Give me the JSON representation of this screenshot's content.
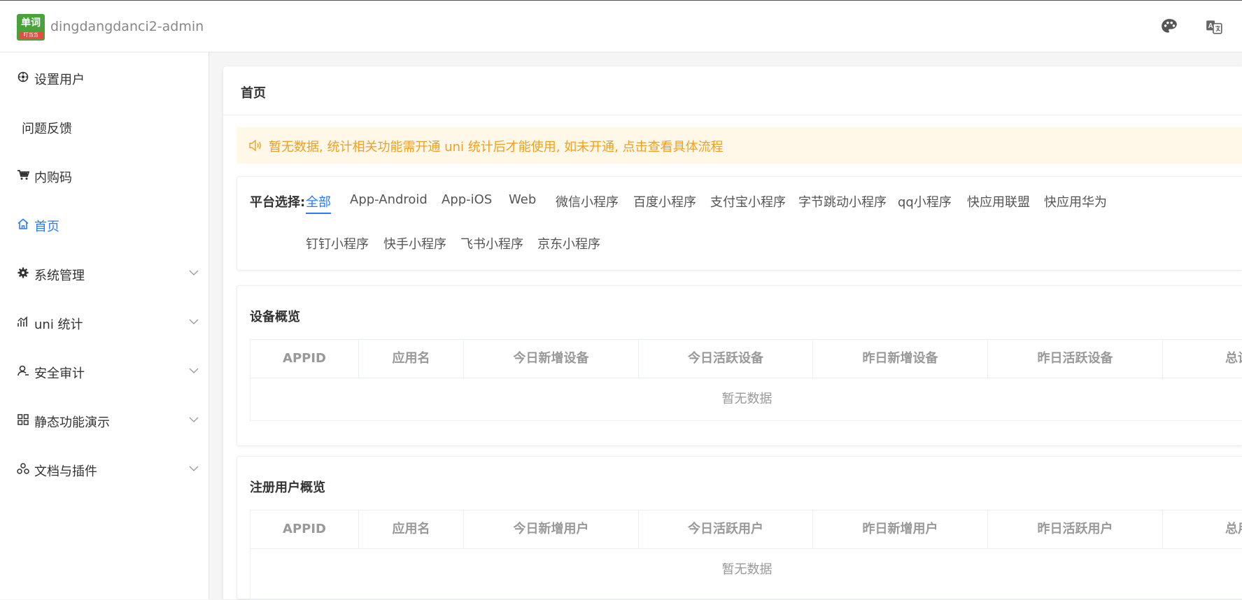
{
  "header": {
    "logo_text": "单词",
    "logo_sub": "叮当当",
    "app_title": "dingdangdanci2-admin",
    "icons": [
      "palette-icon",
      "translate-icon"
    ]
  },
  "sidebar": {
    "items": [
      {
        "label": "设置用户",
        "icon": "settings-user-icon"
      },
      {
        "label": "问题反馈",
        "icon": ""
      },
      {
        "label": "内购码",
        "icon": "cart-icon"
      },
      {
        "label": "首页",
        "icon": "home-icon",
        "active": true
      },
      {
        "label": "系统管理",
        "icon": "gear-icon",
        "expandable": true
      },
      {
        "label": "uni 统计",
        "icon": "stats-icon",
        "expandable": true
      },
      {
        "label": "安全审计",
        "icon": "user-audit-icon",
        "expandable": true
      },
      {
        "label": "静态功能演示",
        "icon": "grid-icon",
        "expandable": true
      },
      {
        "label": "文档与插件",
        "icon": "plugin-icon",
        "expandable": true
      }
    ]
  },
  "main": {
    "title": "首页",
    "notice": "暂无数据, 统计相关功能需开通 uni 统计后才能使用, 如未开通, 点击查看具体流程",
    "platform": {
      "label": "平台选择:",
      "tabs": [
        "全部",
        "App-Android",
        "App-iOS",
        "Web",
        "微信小程序",
        "百度小程序",
        "支付宝小程序",
        "字节跳动小程序",
        "qq小程序",
        "快应用联盟",
        "快应用华为",
        "钉钉小程序",
        "快手小程序",
        "飞书小程序",
        "京东小程序"
      ],
      "selected": "全部"
    },
    "device_overview": {
      "title": "设备概览",
      "columns": [
        "APPID",
        "应用名",
        "今日新增设备",
        "今日活跃设备",
        "昨日新增设备",
        "昨日活跃设备",
        "总设备数"
      ],
      "empty_text": "暂无数据"
    },
    "user_overview": {
      "title": "注册用户概览",
      "columns": [
        "APPID",
        "应用名",
        "今日新增用户",
        "今日活跃用户",
        "昨日新增用户",
        "昨日活跃用户",
        "总用户数"
      ],
      "empty_text": "暂无数据"
    }
  },
  "colors": {
    "accent": "#2979ff",
    "notice_bg": "#fff8e8",
    "notice_text": "#f0a020",
    "logo_green": "#4aa33a"
  }
}
